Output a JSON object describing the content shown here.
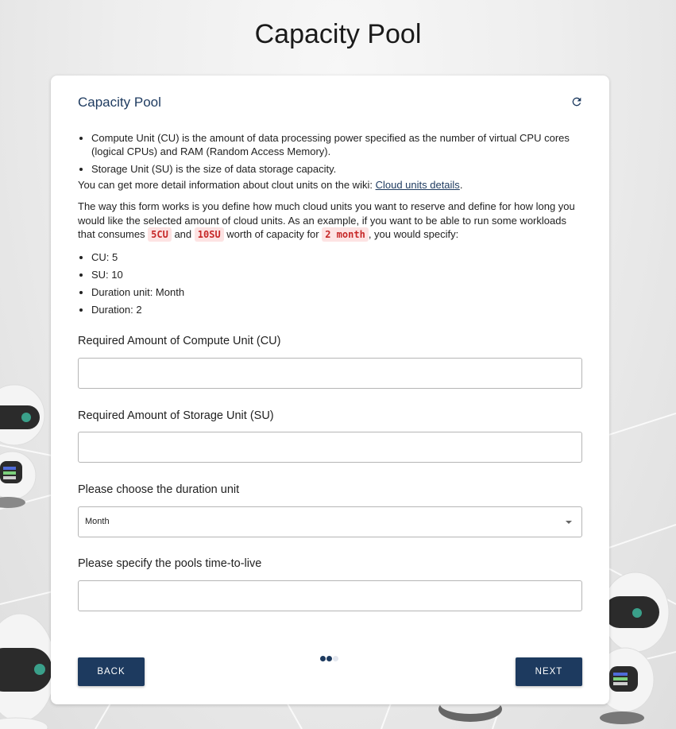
{
  "page": {
    "title": "Capacity Pool"
  },
  "card": {
    "title": "Capacity Pool",
    "refresh_icon": "refresh-icon"
  },
  "intro": {
    "bullets": [
      "Compute Unit (CU) is the amount of data processing power specified as the number of virtual CPU cores (logical CPUs) and RAM (Random Access Memory).",
      "Storage Unit (SU) is the size of data storage capacity."
    ],
    "wiki_text": "You can get more detail information about clout units on the wiki: ",
    "wiki_link": "Cloud units details",
    "wiki_end": ".",
    "explain_1": "The way this form works is you define how much cloud units you want to reserve and define for how long you would like the selected amount of cloud units. As an example, if you want to be able to run some workloads that consumes ",
    "code_cu": "5CU",
    "and": " and ",
    "code_su": "10SU",
    "worth": " worth of capacity for ",
    "code_month": "2 month",
    "specify": ", you would specify:",
    "example_bullets": [
      "CU: 5",
      "SU: 10",
      "Duration unit: Month",
      "Duration: 2"
    ]
  },
  "form": {
    "cu_label": "Required Amount of Compute Unit (CU)",
    "cu_value": "",
    "su_label": "Required Amount of Storage Unit (SU)",
    "su_value": "",
    "duration_unit_label": "Please choose the duration unit",
    "duration_unit_value": "Month",
    "ttl_label": "Please specify the pools time-to-live",
    "ttl_value": ""
  },
  "stepper": {
    "total_steps": 3,
    "current_step": 2
  },
  "buttons": {
    "back": "BACK",
    "next": "NEXT"
  },
  "colors": {
    "primary": "#1d3a5f",
    "code_text": "#c62828",
    "code_bg": "#fde3e3"
  }
}
